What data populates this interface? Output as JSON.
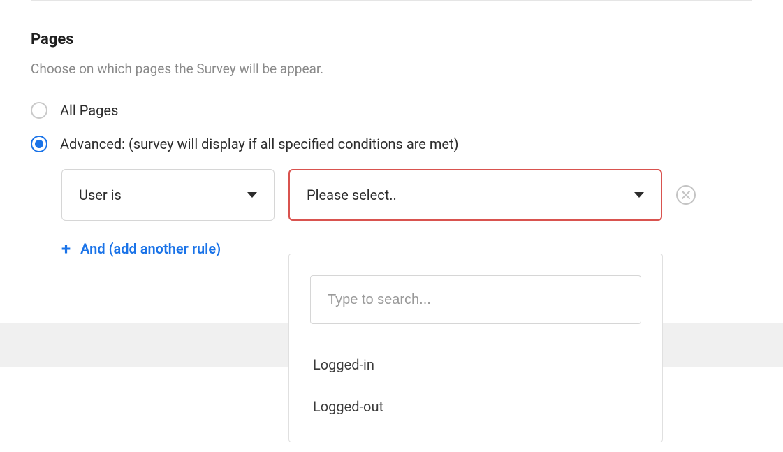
{
  "section": {
    "title": "Pages",
    "description": "Choose on which pages the Survey will be appear."
  },
  "radios": {
    "allPages": "All Pages",
    "advanced": "Advanced: (survey will display if all specified conditions are met)",
    "selected": "advanced"
  },
  "rule": {
    "conditionLabel": "User is",
    "valueLabel": "Please select.."
  },
  "addRule": {
    "text": "And (add another rule)"
  },
  "dropdown": {
    "searchPlaceholder": "Type to search...",
    "options": [
      "Logged-in",
      "Logged-out"
    ]
  }
}
